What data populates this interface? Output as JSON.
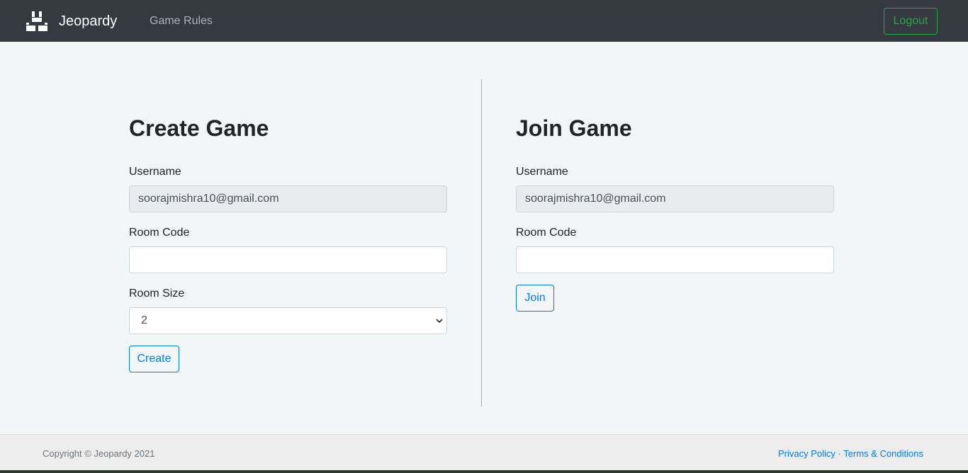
{
  "navbar": {
    "brand": "Jeopardy",
    "brand_icon": "jeopardy-blocks-icon",
    "nav_link": "Game Rules",
    "logout": "Logout",
    "background": "#343a40",
    "accent_success": "#28a745"
  },
  "create_game": {
    "title": "Create Game",
    "username_label": "Username",
    "username_value": "soorajmishra10@gmail.com",
    "room_code_label": "Room Code",
    "room_code_value": "",
    "room_size_label": "Room Size",
    "room_size_value": "2",
    "submit": "Create"
  },
  "join_game": {
    "title": "Join Game",
    "username_label": "Username",
    "username_value": "soorajmishra10@gmail.com",
    "room_code_label": "Room Code",
    "room_code_value": "",
    "submit": "Join"
  },
  "footer": {
    "copyright": "Copyright © Jeopardy 2021",
    "privacy": "Privacy Policy",
    "separator": "·",
    "terms": "Terms & Conditions",
    "link_color": "#007bff"
  }
}
